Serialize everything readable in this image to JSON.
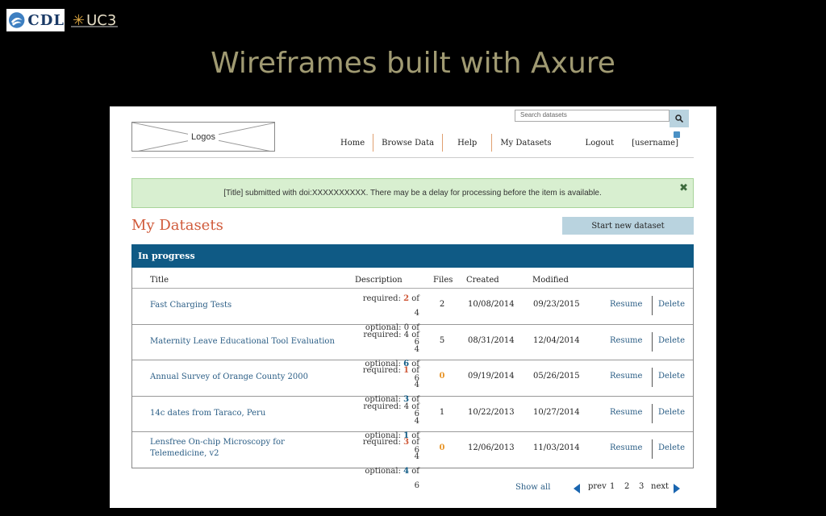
{
  "slide": {
    "logo_cdl": "CDL",
    "logo_uc3": "UC3",
    "title": "Wireframes built with Axure"
  },
  "header": {
    "logo_placeholder": "Logos",
    "search_placeholder": "Search datasets",
    "search_icon": "search-icon",
    "nav": [
      "Home",
      "Browse Data",
      "Help",
      "My Datasets",
      "Logout",
      "[username]"
    ]
  },
  "alert": {
    "message": "[Title] submitted with doi:XXXXXXXXXX. There may be a delay for processing before the item is available.",
    "close_icon": "close-icon"
  },
  "page": {
    "title": "My Datasets",
    "start_button": "Start new dataset"
  },
  "section": {
    "title": "In progress"
  },
  "table": {
    "columns": [
      "Title",
      "Description",
      "Files",
      "Created",
      "Modified"
    ],
    "rows": [
      {
        "title": "Fast Charging Tests",
        "required": "required: ",
        "req_n": "2",
        "req_total": " of 4",
        "optional": "optional: ",
        "opt_n": "0",
        "opt_total": " of 6",
        "files": "2",
        "created": "10/08/2014",
        "modified": "09/23/2015",
        "resume": "Resume",
        "delete": "Delete"
      },
      {
        "title": "Maternity Leave Educational Tool Evaluation",
        "required": "required: ",
        "req_n": "4",
        "req_total": " of 4",
        "optional": "optional: ",
        "opt_n": "6",
        "opt_total": " of 6",
        "files": "5",
        "created": "08/31/2014",
        "modified": "12/04/2014",
        "resume": "Resume",
        "delete": "Delete"
      },
      {
        "title": "Annual Survey of Orange County 2000",
        "required": "required: ",
        "req_n": "1",
        "req_total": " of 4",
        "optional": "optional: ",
        "opt_n": "3",
        "opt_total": " of 6",
        "files": "0",
        "created": "09/19/2014",
        "modified": "05/26/2015",
        "resume": "Resume",
        "delete": "Delete"
      },
      {
        "title": "14c dates from Taraco, Peru",
        "required": "required: ",
        "req_n": "4",
        "req_total": " of 4",
        "optional": "optional: ",
        "opt_n": "1",
        "opt_total": " of 6",
        "files": "1",
        "created": "10/22/2013",
        "modified": "10/27/2014",
        "resume": "Resume",
        "delete": "Delete"
      },
      {
        "title": "Lensfree On-chip Microscopy for Telemedicine, v2",
        "required": "required: ",
        "req_n": "3",
        "req_total": " of 4",
        "optional": "optional: ",
        "opt_n": "4",
        "opt_total": " of 6",
        "files": "0",
        "created": "12/06/2013",
        "modified": "11/03/2014",
        "resume": "Resume",
        "delete": "Delete"
      }
    ]
  },
  "pager": {
    "show_all": "Show all",
    "prev": "prev",
    "pages": [
      "1",
      "2",
      "3"
    ],
    "next": "next"
  },
  "colors": {
    "section_bar": "#0f5a85",
    "title_red": "#d05a3a",
    "link_blue": "#2a5d85",
    "alert_green": "#d8efd0"
  }
}
